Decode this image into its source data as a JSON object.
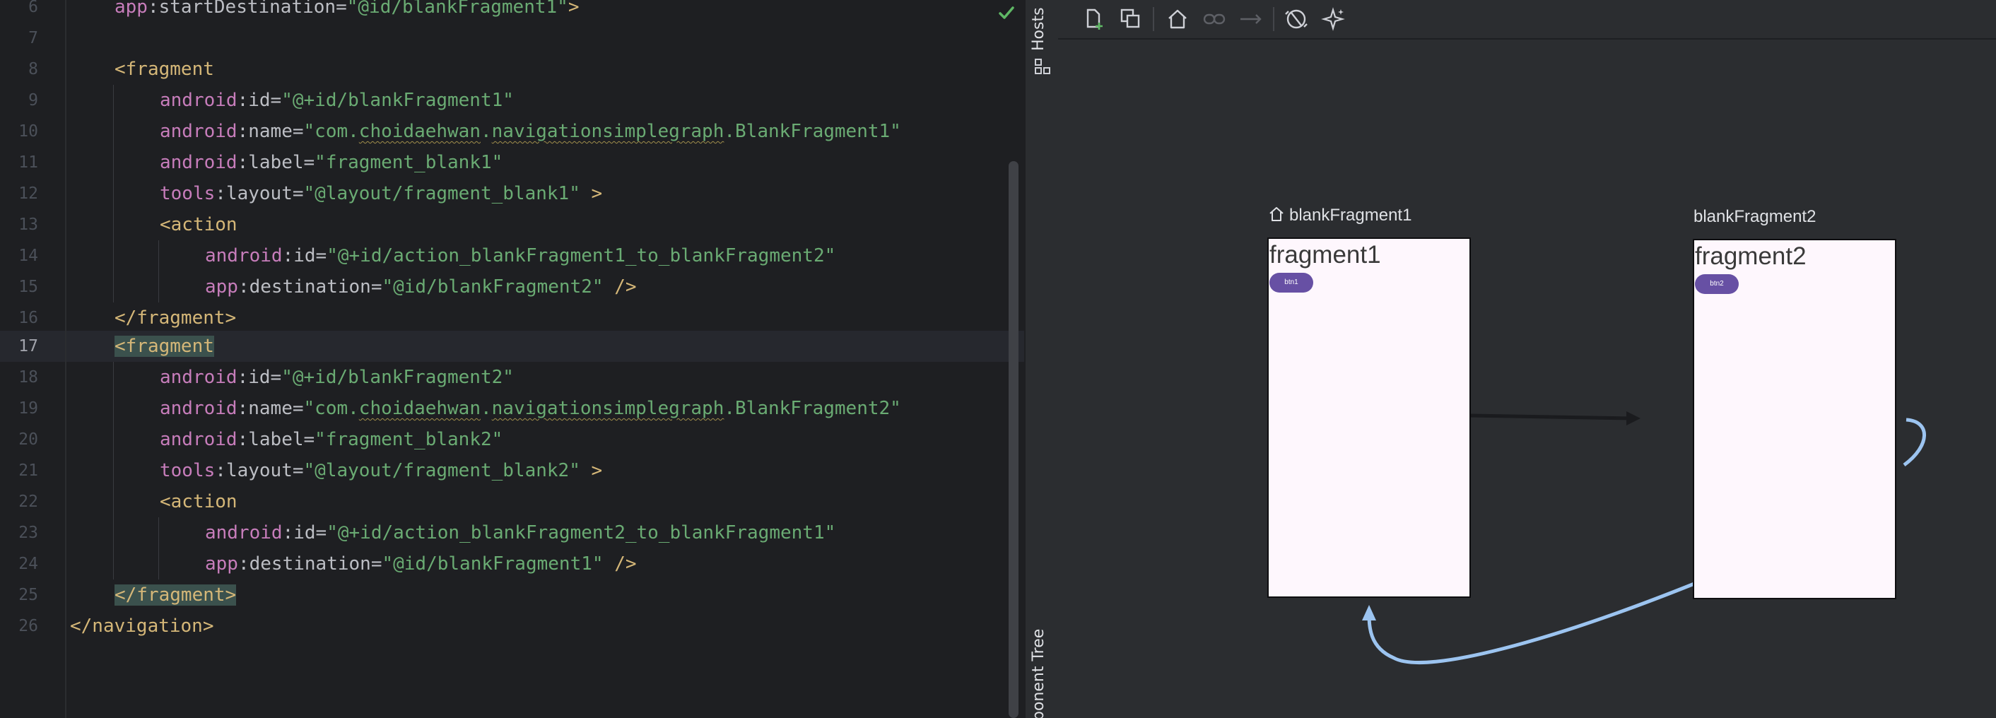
{
  "editor": {
    "line_numbers": [
      "6",
      "7",
      "8",
      "9",
      "10",
      "11",
      "12",
      "13",
      "14",
      "15",
      "16",
      "17",
      "18",
      "19",
      "20",
      "21",
      "22",
      "23",
      "24",
      "25",
      "26"
    ],
    "current_line": "17",
    "lines": {
      "l6": {
        "ns": "app",
        "sep": ":",
        "attr": "startDestination",
        "eq": "=",
        "val": "\"@id/blankFragment1\"",
        "close": ">"
      },
      "l8": {
        "tag": "<fragment"
      },
      "l9": {
        "ns": "android",
        "sep": ":",
        "attr": "id",
        "eq": "=",
        "val": "\"@+id/blankFragment1\""
      },
      "l10": {
        "ns": "android",
        "sep": ":",
        "attr": "name",
        "eq": "=",
        "q": "\"com.",
        "w1": "choidaehwan",
        "dot": ".",
        "w2": "navigationsimplegraph",
        ".rest": ".BlankFragment1\"",
        "rest": ".BlankFragment1\""
      },
      "l11": {
        "ns": "android",
        "sep": ":",
        "attr": "label",
        "eq": "=",
        "val": "\"fragment_blank1\""
      },
      "l12": {
        "ns": "tools",
        "sep": ":",
        "attr": "layout",
        "eq": "=",
        "val": "\"@layout/fragment_blank1\"",
        "close": " >"
      },
      "l13": {
        "tag": "<action"
      },
      "l14": {
        "ns": "android",
        "sep": ":",
        "attr": "id",
        "eq": "=",
        "val": "\"@+id/action_blankFragment1_to_blankFragment2\""
      },
      "l15": {
        "ns": "app",
        "sep": ":",
        "attr": "destination",
        "eq": "=",
        "val": "\"@id/blankFragment2\"",
        "close": " />"
      },
      "l16": {
        "tag": "</fragment>"
      },
      "l17": {
        "tag": "<fragment"
      },
      "l18": {
        "ns": "android",
        "sep": ":",
        "attr": "id",
        "eq": "=",
        "val": "\"@+id/blankFragment2\""
      },
      "l19": {
        "ns": "android",
        "sep": ":",
        "attr": "name",
        "eq": "=",
        "q": "\"com.",
        "w1": "choidaehwan",
        "dot": ".",
        "w2": "navigationsimplegraph",
        "rest": ".BlankFragment2\""
      },
      "l20": {
        "ns": "android",
        "sep": ":",
        "attr": "label",
        "eq": "=",
        "val": "\"fragment_blank2\""
      },
      "l21": {
        "ns": "tools",
        "sep": ":",
        "attr": "layout",
        "eq": "=",
        "val": "\"@layout/fragment_blank2\"",
        "close": " >"
      },
      "l22": {
        "tag": "<action"
      },
      "l23": {
        "ns": "android",
        "sep": ":",
        "attr": "id",
        "eq": "=",
        "val": "\"@+id/action_blankFragment2_to_blankFragment1\""
      },
      "l24": {
        "ns": "app",
        "sep": ":",
        "attr": "destination",
        "eq": "=",
        "val": "\"@id/blankFragment1\"",
        "close": " />"
      },
      "l25": {
        "tag": "</fragment>"
      },
      "l26": {
        "tag": "</navigation>"
      }
    }
  },
  "side_tabs": {
    "hosts": "Hosts",
    "component_tree": "ponent Tree"
  },
  "toolbar": {
    "icons": [
      "new-destination-icon",
      "new-nested-graph-icon",
      "assign-start-destination-icon",
      "deep-link-icon",
      "add-action-icon",
      "auto-arrange-icon",
      "magic-assist-icon"
    ]
  },
  "graph": {
    "fragments": [
      {
        "title": "blankFragment1",
        "screen_text": "fragment1",
        "button": "btn1",
        "is_start": true
      },
      {
        "title": "blankFragment2",
        "screen_text": "fragment2",
        "button": "btn2",
        "is_start": false
      }
    ]
  },
  "colors": {
    "tag": "#d5b778",
    "namespace": "#c77dbb",
    "string": "#6aab73",
    "arrow_selected": "#9cc4f0",
    "arrow_default": "#1a1b1e",
    "button": "#6750a4"
  }
}
